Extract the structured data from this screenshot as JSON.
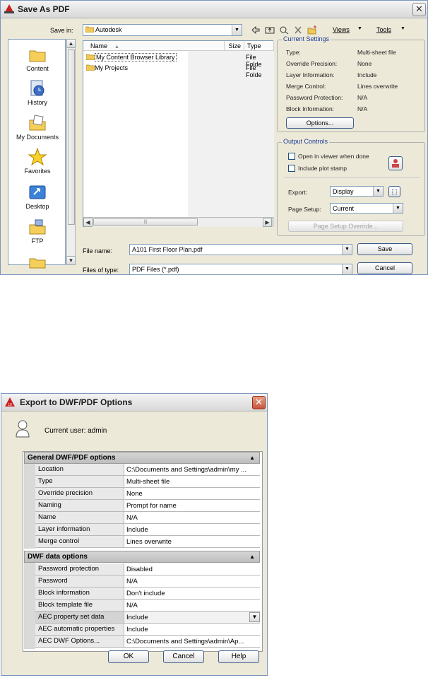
{
  "save_dialog": {
    "title": "Save As PDF",
    "save_in_label": "Save in:",
    "save_in_value": "Autodesk",
    "views_label": "Views",
    "tools_label": "Tools",
    "places": [
      "Content",
      "History",
      "My Documents",
      "Favorites",
      "Desktop",
      "FTP"
    ],
    "columns": {
      "name": "Name",
      "size": "Size",
      "type": "Type"
    },
    "files": [
      {
        "name": "My Content Browser Library",
        "type": "File Folde"
      },
      {
        "name": "My Projects",
        "type": "File Folde"
      }
    ],
    "current_settings": {
      "label": "Current Settings",
      "rows": [
        {
          "key": "Type:",
          "value": "Multi-sheet file"
        },
        {
          "key": "Override Precision:",
          "value": "None"
        },
        {
          "key": "Layer Information:",
          "value": "Include"
        },
        {
          "key": "Merge Control:",
          "value": "Lines overwrite"
        },
        {
          "key": "Password Protection:",
          "value": "N/A"
        },
        {
          "key": "Block Information:",
          "value": "N/A"
        }
      ],
      "options_button": "Options..."
    },
    "output_controls": {
      "label": "Output Controls",
      "open_viewer": "Open in viewer when done",
      "include_stamp": "Include plot stamp",
      "export_label": "Export:",
      "export_value": "Display",
      "page_setup_label": "Page Setup:",
      "page_setup_value": "Current",
      "override_button": "Page Setup Override..."
    },
    "file_name_label": "File name:",
    "file_name_value": "A101 First Floor Plan.pdf",
    "file_type_label": "Files of type:",
    "file_type_value": "PDF Files (*.pdf)",
    "save_button": "Save",
    "cancel_button": "Cancel"
  },
  "export_dialog": {
    "title": "Export to DWF/PDF Options",
    "current_user": "Current user: admin",
    "general_header": "General DWF/PDF options",
    "general_rows": [
      {
        "name": "Location",
        "value": "C:\\Documents and Settings\\admin\\my ..."
      },
      {
        "name": "Type",
        "value": "Multi-sheet file"
      },
      {
        "name": "Override precision",
        "value": "None"
      },
      {
        "name": "Naming",
        "value": "Prompt for name"
      },
      {
        "name": "Name",
        "value": "N/A"
      },
      {
        "name": "Layer information",
        "value": "Include"
      },
      {
        "name": "Merge control",
        "value": "Lines overwrite"
      }
    ],
    "dwf_header": "DWF data options",
    "dwf_rows": [
      {
        "name": "Password protection",
        "value": "Disabled"
      },
      {
        "name": "Password",
        "value": "N/A"
      },
      {
        "name": "Block information",
        "value": "Don't include"
      },
      {
        "name": "Block template file",
        "value": "N/A"
      },
      {
        "name": "AEC property set data",
        "value": "Include"
      },
      {
        "name": "AEC automatic properties",
        "value": "Include"
      },
      {
        "name": "AEC DWF Options...",
        "value": "C:\\Documents and Settings\\admin\\Ap..."
      }
    ],
    "ok_button": "OK",
    "cancel_button": "Cancel",
    "help_button": "Help"
  }
}
